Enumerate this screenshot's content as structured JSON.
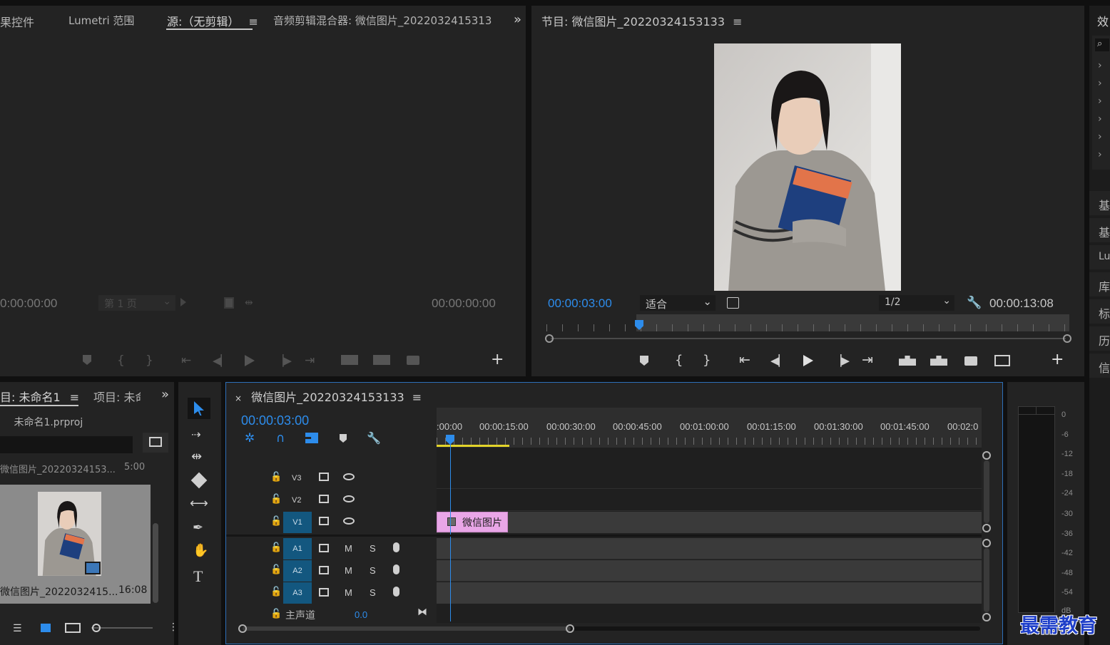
{
  "source_panel": {
    "tabs": [
      "果控件",
      "Lumetri 范围",
      "源:（无剪辑）",
      "音频剪辑混合器: 微信图片_2022032415313"
    ],
    "active_tab_index": 2,
    "timecode_left": "0:00:00:00",
    "page_dropdown": "第 1 页",
    "timecode_right": "00:00:00:00"
  },
  "program_panel": {
    "title": "节目: 微信图片_20220324153133",
    "timecode_current": "00:00:03:00",
    "fit_dropdown": "适合",
    "resolution_dropdown": "1/2",
    "timecode_duration": "00:00:13:08",
    "playhead_fraction": 0.175
  },
  "project_panel": {
    "tab_active": "目: 未命名1",
    "tab_other": "项目: 未命",
    "project_file": "未命名1.prproj",
    "search_value": "",
    "items": [
      {
        "name_short": "微信图片_20220324153...",
        "duration_short": "5:00"
      },
      {
        "name": "微信图片_2022032415...",
        "duration": "16:08"
      }
    ]
  },
  "timeline": {
    "sequence_name": "微信图片_20220324153133",
    "timecode": "00:00:03:00",
    "ruler": [
      ":00:00",
      "00:00:15:00",
      "00:00:30:00",
      "00:00:45:00",
      "00:01:00:00",
      "00:01:15:00",
      "00:01:30:00",
      "00:01:45:00",
      "00:02:0"
    ],
    "video_tracks": [
      "V3",
      "V2",
      "V1"
    ],
    "audio_tracks": [
      "A1",
      "A2",
      "A3"
    ],
    "track_mute": "M",
    "track_solo": "S",
    "master_label": "主声道",
    "master_value": "0.0",
    "clip_label": "微信图片",
    "clip_color": "#e9a6e7"
  },
  "right_panel": {
    "tab_top": "效",
    "items": [
      "基",
      "基",
      "Lu",
      "库",
      "标",
      "历",
      "信"
    ]
  },
  "audio_meter": {
    "labels": [
      "0",
      "-6",
      "-12",
      "-18",
      "-24",
      "-30",
      "-36",
      "-42",
      "-48",
      "-54",
      "dB"
    ]
  },
  "watermark": "最需教育",
  "colors": {
    "accent": "#2d8ceb",
    "panel_bg": "#232323",
    "clip": "#e9a6e7",
    "track_target": "#13577f"
  }
}
